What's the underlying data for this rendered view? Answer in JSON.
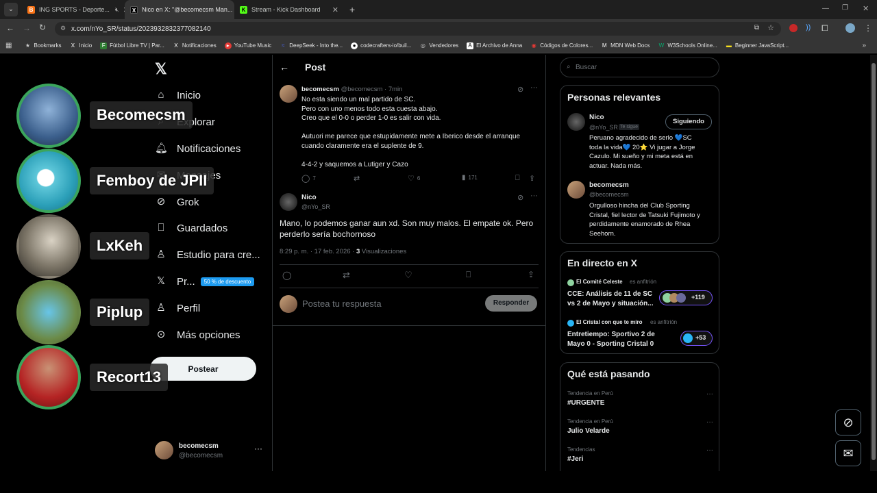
{
  "browser": {
    "tabs": [
      {
        "label": "ING SPORTS - Deporte...",
        "color": "#f97316",
        "glyph": "B"
      },
      {
        "label": "Nico en X: \"@becomecsm Man...",
        "color": "#000000",
        "glyph": "X"
      },
      {
        "label": "Stream - Kick Dashboard",
        "color": "#53fc18",
        "glyph": "K"
      }
    ],
    "url": "x.com/nYo_SR/status/2023932832377082140",
    "bookmarks": [
      "Bookmarks",
      "Inicio",
      "Fútbol Libre TV | Par...",
      "Notificaciones",
      "YouTube Music",
      "DeepSeek - Into the...",
      "codecrafters-io/buil...",
      "Vendedores",
      "El Archivo de Anna",
      "Códigos de Colores...",
      "MDN Web Docs",
      "W3Schools Online...",
      "Beginner JavaScript..."
    ]
  },
  "overlay": {
    "names": [
      "Becomecsm",
      "Femboy de JPII",
      "LxKeh",
      "Piplup",
      "Recort13"
    ]
  },
  "nav": {
    "home": "Inicio",
    "explore": "Explorar",
    "notifications": "Notificaciones",
    "messages": "Mensajes",
    "grok": "Grok",
    "bookmarks": "Guardados",
    "studio": "Estudio para cre...",
    "premium": "Pr...",
    "premium_badge": "50 % de descuento",
    "profile": "Perfil",
    "more": "Más opciones",
    "post": "Postear",
    "account_name": "becomecsm",
    "account_handle": "@becomecsm"
  },
  "header": {
    "title": "Post"
  },
  "tweet1": {
    "name": "becomecsm",
    "handle": "@becomecsm · 7min",
    "line1": "No esta siendo un mal partido de SC.",
    "line2": "Pero con uno menos todo esta cuesta abajo.",
    "line3": "Creo que el 0-0 o perder 1-0 es salir con vida.",
    "line4": "Autuori me parece que estupidamente mete a Iberico desde el arranque",
    "line5": "cuando claramente era el suplente de 9.",
    "line6": "4-4-2 y saquemos a Lutiger y Cazo",
    "replies": "7",
    "likes": "6",
    "views": "171"
  },
  "tweet2": {
    "name": "Nico",
    "handle": "@nYo_SR",
    "text1": "Mano, lo podemos ganar aun xd. Son muy malos. El empate ok. Pero",
    "text2": "perderlo sería bochornoso",
    "meta": "8:29 p. m. · 17 feb. 2026 · ",
    "views": "3",
    "views_label": " Visualizaciones"
  },
  "reply": {
    "placeholder": "Postea tu respuesta",
    "button": "Responder"
  },
  "search": {
    "placeholder": "Buscar"
  },
  "relevant": {
    "title": "Personas relevantes",
    "p1": {
      "name": "Nico",
      "handle": "@nYo_SR",
      "badge": "Te sigue",
      "button": "Siguiendo",
      "bio1": "Peruano agradecido de serlo 💙SC",
      "bio2": "toda la vida💙 20⭐ Vi jugar a Jorge",
      "bio3": "Cazulo. Mi sueño y mi meta está en",
      "bio4": "actuar. Nada más."
    },
    "p2": {
      "name": "becomecsm",
      "handle": "@becomecsm",
      "bio1": "Orgulloso hincha del Club Sporting",
      "bio2": "Cristal, fiel lector de Tatsuki Fujimoto y",
      "bio3": "perdidamente enamorado de Rhea",
      "bio4": "Seehorn."
    }
  },
  "live": {
    "title": "En directo en X",
    "s1": {
      "host": "El Comité Celeste",
      "host_suffix": " es anfitrión",
      "title1": "CCE: Análisis de 11 de SC",
      "title2": "vs 2 de Mayo y situación...",
      "count": "+119"
    },
    "s2": {
      "host": "El Cristal con que te miro",
      "host_suffix": " es anfitrión",
      "title1": "Entretiempo: Sportivo 2 de",
      "title2": "Mayo 0 - Sporting Cristal 0",
      "count": "+53"
    }
  },
  "trends": {
    "title": "Qué está pasando",
    "items": [
      {
        "context": "Tendencia en Perú",
        "name": "#URGENTE"
      },
      {
        "context": "Tendencia en Perú",
        "name": "Julio Velarde"
      },
      {
        "context": "Tendencias",
        "name": "#Jeri"
      }
    ]
  }
}
